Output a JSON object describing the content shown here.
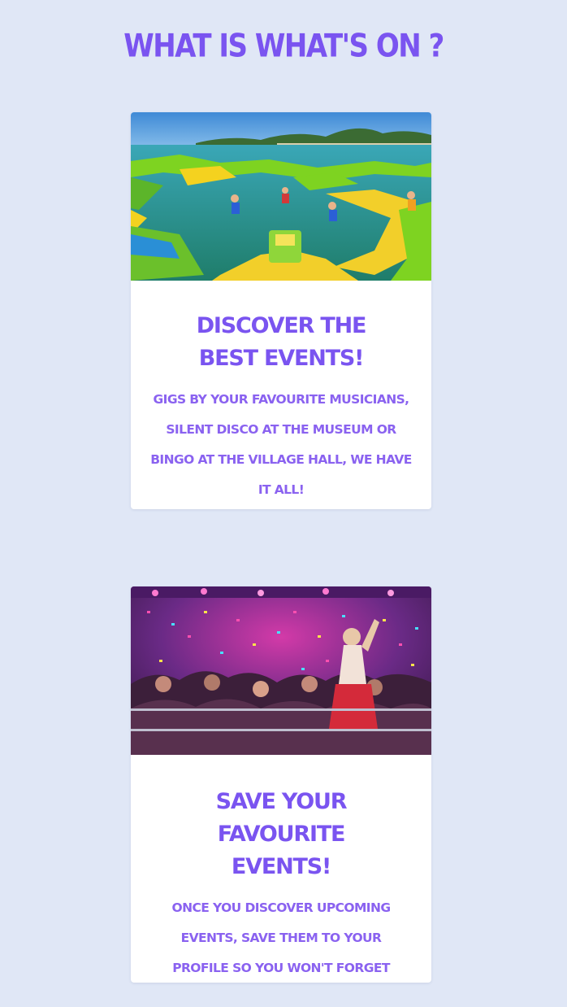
{
  "page": {
    "title": "WHAT IS WHAT'S ON ?"
  },
  "cards": [
    {
      "image_subject": "inflatable water park on a sunny beach",
      "heading": "DISCOVER THE BEST EVENTS!",
      "text": "GIGS BY YOUR FAVOURITE MUSICIANS, SILENT DISCO AT THE MUSEUM OR BINGO AT THE VILLAGE HALL, WE HAVE IT ALL!"
    },
    {
      "image_subject": "party crowd with confetti and pink lights",
      "heading": "SAVE YOUR FAVOURITE EVENTS!",
      "text": "ONCE YOU DISCOVER UPCOMING EVENTS, SAVE THEM TO YOUR PROFILE SO YOU WON'T FORGET THEM!"
    }
  ],
  "colors": {
    "background": "#e0e7f6",
    "accent": "#7a54f0",
    "card": "#ffffff"
  }
}
